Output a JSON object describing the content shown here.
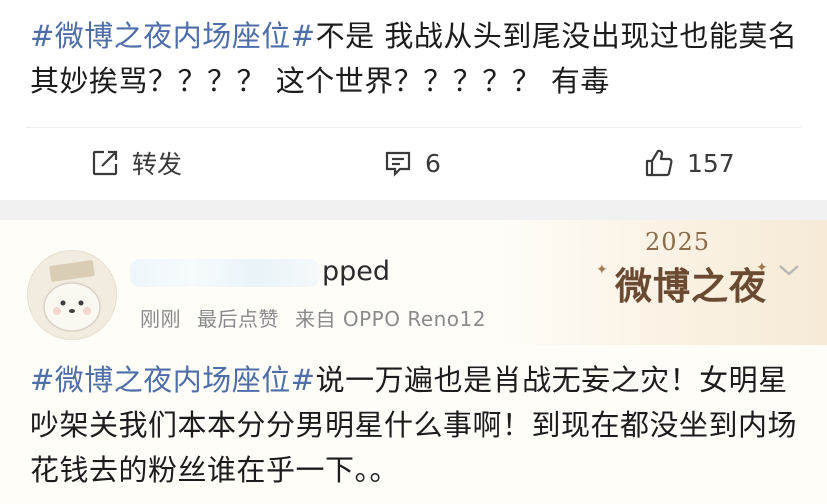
{
  "post1": {
    "hashtag": "#微博之夜内场座位#",
    "text": "不是 我战从头到尾没出现过也能莫名其妙挨骂？？？？ 这个世界？？？？？ 有毒",
    "actions": {
      "repost_label": "转发",
      "comment_count": "6",
      "like_count": "157"
    }
  },
  "post2": {
    "username_visible": "pped",
    "meta": {
      "time": "刚刚",
      "last_like": "最后点赞",
      "source": "来自 OPPO Reno12"
    },
    "hashtag": "#微博之夜内场座位#",
    "text": "说一万遍也是肖战无妄之灾！女明星吵架关我们本本分分男明星什么事啊！到现在都没坐到内场花钱去的粉丝谁在乎一下。。",
    "banner": {
      "year": "2025",
      "title": "微博之夜"
    }
  },
  "colors": {
    "hashtag": "#4d6ea8",
    "text": "#1c1c1c",
    "meta": "#8a8a8a",
    "banner_text": "#6b4a32"
  },
  "icons": [
    "repost-icon",
    "comment-icon",
    "like-icon",
    "chevron-down-icon"
  ]
}
